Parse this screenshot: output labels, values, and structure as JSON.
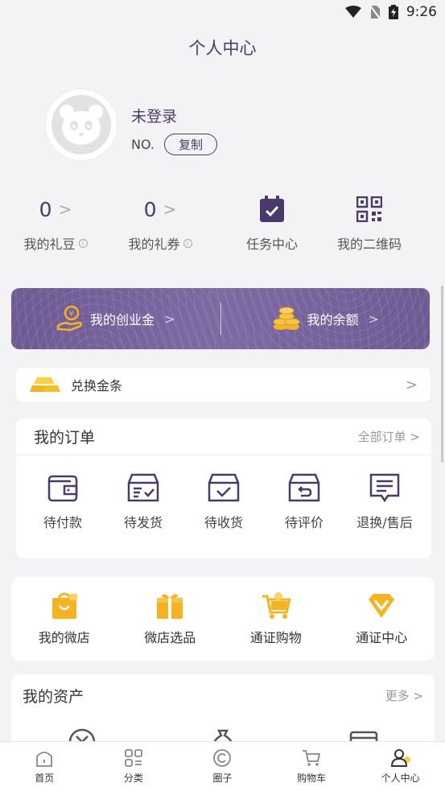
{
  "status_bar": {
    "time": "9:26",
    "icons": [
      "wifi-icon",
      "no-sim-icon",
      "battery-charging-icon"
    ]
  },
  "page": {
    "title": "个人中心"
  },
  "profile": {
    "username": "未登录",
    "no_label": "NO.",
    "copy_label": "复制",
    "avatar_icon": "panda-avatar-icon"
  },
  "stats": [
    {
      "value": "0",
      "label": "我的礼豆"
    },
    {
      "value": "0",
      "label": "我的礼券"
    },
    {
      "icon": "calendar-check-icon",
      "label": "任务中心"
    },
    {
      "icon": "qr-code-icon",
      "label": "我的二维码"
    }
  ],
  "banner": {
    "left_label": "我的创业金",
    "right_label": "我的余额",
    "left_icon": "hand-coin-icon",
    "right_icon": "coin-stack-icon",
    "color": "#6d5a93"
  },
  "gold_bar": {
    "label": "兑换金条",
    "icon": "gold-bar-icon"
  },
  "orders": {
    "title": "我的订单",
    "all_label": "全部订单 >",
    "items": [
      {
        "label": "待付款",
        "icon": "wallet-icon"
      },
      {
        "label": "待发货",
        "icon": "box-list-icon"
      },
      {
        "label": "待收货",
        "icon": "box-check-icon"
      },
      {
        "label": "待评价",
        "icon": "box-return-icon"
      },
      {
        "label": "退换/售后",
        "icon": "document-icon"
      }
    ]
  },
  "shop": [
    {
      "label": "我的微店",
      "icon": "shop-bag-icon"
    },
    {
      "label": "微店选品",
      "icon": "gift-box-icon"
    },
    {
      "label": "通证购物",
      "icon": "shopping-cart-icon"
    },
    {
      "label": "通证中心",
      "icon": "diamond-icon"
    }
  ],
  "assets": {
    "title": "我的资产",
    "more_label": "更多 >"
  },
  "tabbar": [
    {
      "label": "首页",
      "icon": "home-icon"
    },
    {
      "label": "分类",
      "icon": "grid-icon"
    },
    {
      "label": "圈子",
      "icon": "circle-icon"
    },
    {
      "label": "购物车",
      "icon": "cart-icon"
    },
    {
      "label": "个人中心",
      "icon": "person-icon"
    }
  ],
  "colors": {
    "primary": "#4a3a6b",
    "accent_gold": "#f5b324"
  }
}
